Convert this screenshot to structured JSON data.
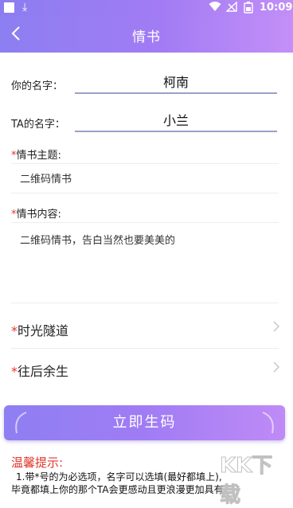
{
  "statusbar": {
    "time": "10:09"
  },
  "navbar": {
    "title": "情书"
  },
  "form": {
    "your_name_label": "你的名字：",
    "your_name_value": "柯南",
    "ta_name_label": "TA的名字：",
    "ta_name_value": "小兰",
    "required_mark": "*",
    "subject_label": "情书主题:",
    "subject_value": "二维码情书",
    "content_label": "情书内容:",
    "content_value": "二维码情书，告白当然也要美美的",
    "time_tunnel_label": "时光隧道",
    "future_life_label": "往后余生"
  },
  "button": {
    "generate_label": "立即生码"
  },
  "tips": {
    "title": "温馨提示:",
    "line1": "1.带*号的为必选项，名字可以选填(最好都填上),",
    "line2": "毕竟都填上你的那个TA会更感动且更浪漫更加具有"
  },
  "watermark": {
    "text": "KK下载"
  },
  "colors": {
    "accent": "#a27cf4",
    "required": "#e0362c"
  }
}
